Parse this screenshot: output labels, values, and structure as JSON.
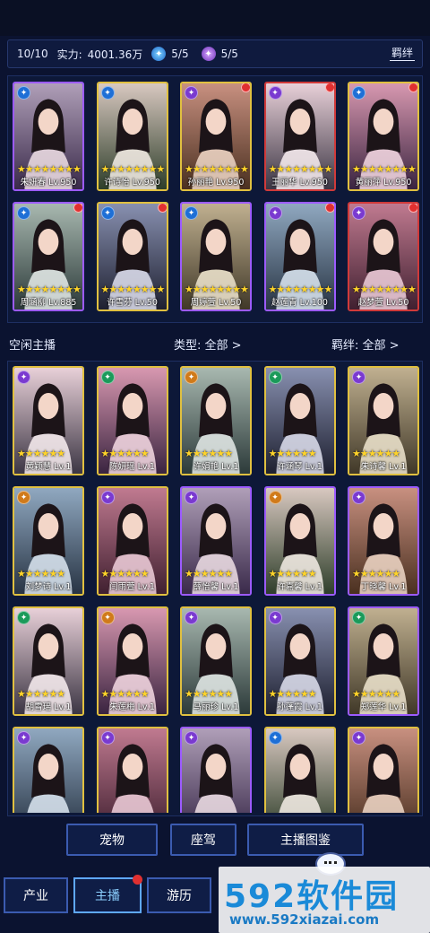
{
  "status": {
    "count": "10/10",
    "power_label": "实力:",
    "power_value": "4001.36万",
    "resource1": "5/5",
    "resource2": "5/5",
    "bond_button": "羁绊"
  },
  "active_cards": [
    {
      "name": "朱妍春 Lv.950",
      "border": "purple",
      "element": "blue",
      "stars": 8,
      "dot": false
    },
    {
      "name": "许诗怡 Lv.950",
      "border": "yellow",
      "element": "blue",
      "stars": 8,
      "dot": false
    },
    {
      "name": "孙丽艳 Lv.950",
      "border": "yellow",
      "element": "purple",
      "stars": 8,
      "dot": true
    },
    {
      "name": "王丽华 Lv.950",
      "border": "red",
      "element": "purple",
      "stars": 8,
      "dot": true
    },
    {
      "name": "黄丽萍 Lv.950",
      "border": "yellow",
      "element": "blue",
      "stars": 8,
      "dot": true
    },
    {
      "name": "周涵柳 Lv.885",
      "border": "purple",
      "element": "blue",
      "stars": 8,
      "dot": true
    },
    {
      "name": "许雪芬 Lv.50",
      "border": "yellow",
      "element": "blue",
      "stars": 8,
      "dot": true
    },
    {
      "name": "周婷萱 Lv.50",
      "border": "purple",
      "element": "blue",
      "stars": 8,
      "dot": false
    },
    {
      "name": "赵莲青 Lv.100",
      "border": "purple",
      "element": "purple",
      "stars": 8,
      "dot": true
    },
    {
      "name": "赵梦萱 Lv.50",
      "border": "red",
      "element": "purple",
      "stars": 8,
      "dot": true
    }
  ],
  "idle_section": {
    "title": "空闲主播",
    "type_filter": "类型: 全部 >",
    "bond_filter": "羁绊: 全部 >"
  },
  "idle_cards": [
    {
      "name": "黄颖慧 Lv.1",
      "border": "yellow",
      "element": "purple",
      "stars": 6
    },
    {
      "name": "陈妍瑶 Lv.1",
      "border": "yellow",
      "element": "green",
      "stars": 6
    },
    {
      "name": "许娟艳 Lv.1",
      "border": "yellow",
      "element": "orange",
      "stars": 6
    },
    {
      "name": "许涵琴 Lv.1",
      "border": "yellow",
      "element": "green",
      "stars": 6
    },
    {
      "name": "朱诗馨 Lv.1",
      "border": "yellow",
      "element": "purple",
      "stars": 6
    },
    {
      "name": "刘梦诗 Lv.1",
      "border": "yellow",
      "element": "orange",
      "stars": 6
    },
    {
      "name": "闫雨萱 Lv.1",
      "border": "yellow",
      "element": "purple",
      "stars": 6
    },
    {
      "name": "薛怡馨 Lv.1",
      "border": "purple",
      "element": "purple",
      "stars": 6
    },
    {
      "name": "许嘉馨 Lv.1",
      "border": "purple",
      "element": "orange",
      "stars": 6
    },
    {
      "name": "丁晓馨 Lv.1",
      "border": "purple",
      "element": "purple",
      "stars": 6
    },
    {
      "name": "胡雪瑶 Lv.1",
      "border": "yellow",
      "element": "green",
      "stars": 6
    },
    {
      "name": "朱莲梅 Lv.1",
      "border": "yellow",
      "element": "orange",
      "stars": 6
    },
    {
      "name": "马丽珍 Lv.1",
      "border": "yellow",
      "element": "purple",
      "stars": 6
    },
    {
      "name": "孙蓬霞 Lv.1",
      "border": "yellow",
      "element": "purple",
      "stars": 6
    },
    {
      "name": "郑莲华 Lv.1",
      "border": "purple",
      "element": "green",
      "stars": 6
    },
    {
      "name": "",
      "border": "yellow",
      "element": "purple",
      "stars": 0
    },
    {
      "name": "",
      "border": "yellow",
      "element": "purple",
      "stars": 0
    },
    {
      "name": "",
      "border": "purple",
      "element": "purple",
      "stars": 0
    },
    {
      "name": "",
      "border": "yellow",
      "element": "blue",
      "stars": 0
    },
    {
      "name": "",
      "border": "yellow",
      "element": "purple",
      "stars": 0
    }
  ],
  "actions": {
    "pet": "宠物",
    "mount": "座驾",
    "gallery": "主播图鉴"
  },
  "nav": {
    "industry": "产业",
    "streamer": "主播",
    "travel": "游历"
  },
  "watermark": {
    "main": "592软件园",
    "url": "www.592xiazai.com"
  },
  "colors": {
    "background": "#0b1330",
    "star": "#ffd42a",
    "badge": "#e03030",
    "accent": "#3b5bb0"
  }
}
